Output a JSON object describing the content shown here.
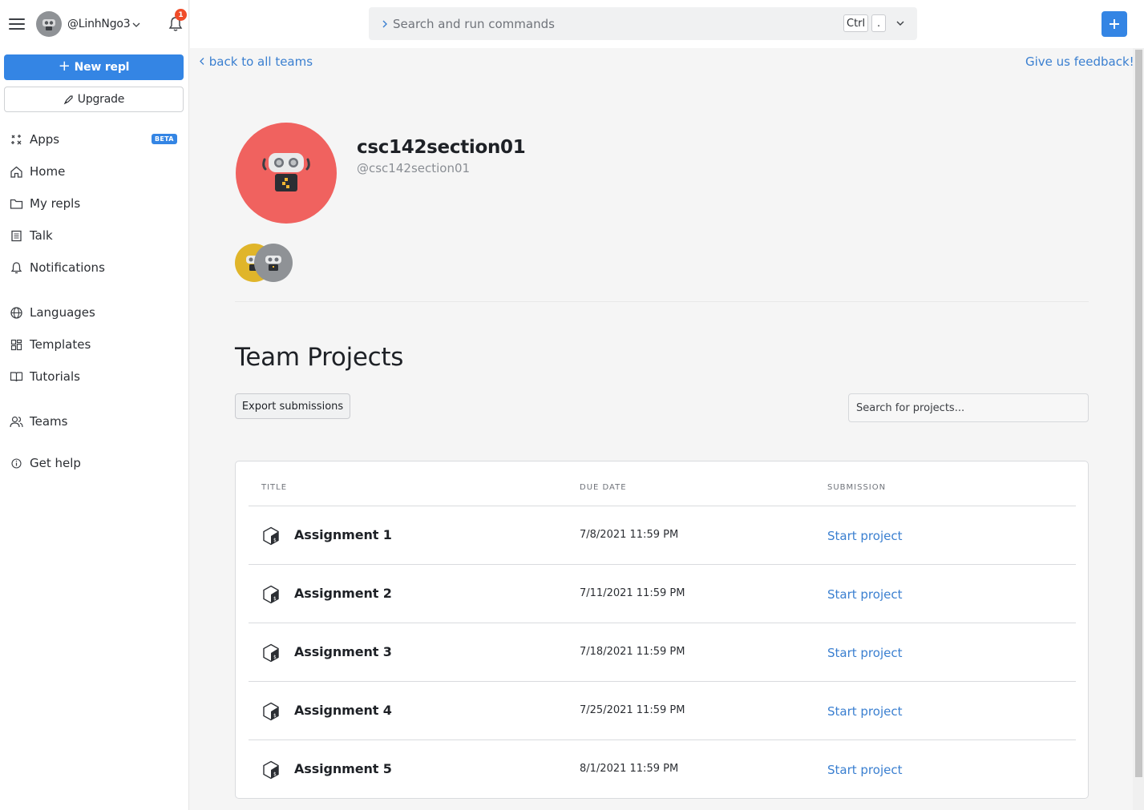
{
  "header": {
    "username": "@LinhNgo3",
    "notification_count": "1",
    "search_placeholder": "Search and run commands",
    "kbd_ctrl": "Ctrl",
    "kbd_dot": "."
  },
  "sidebar": {
    "new_repl_label": "New repl",
    "upgrade_label": "Upgrade",
    "beta_badge": "BETA",
    "items": [
      {
        "label": "Apps",
        "icon": "apps-icon"
      },
      {
        "label": "Home",
        "icon": "home-icon"
      },
      {
        "label": "My repls",
        "icon": "folder-icon"
      },
      {
        "label": "Talk",
        "icon": "talk-icon"
      },
      {
        "label": "Notifications",
        "icon": "bell-icon"
      },
      {
        "label": "Languages",
        "icon": "globe-icon"
      },
      {
        "label": "Templates",
        "icon": "templates-icon"
      },
      {
        "label": "Tutorials",
        "icon": "book-icon"
      },
      {
        "label": "Teams",
        "icon": "teams-icon"
      },
      {
        "label": "Get help",
        "icon": "info-icon"
      }
    ]
  },
  "page": {
    "back_link": "back to all teams",
    "feedback_link": "Give us feedback!",
    "team_name": "csc142section01",
    "team_handle": "@csc142section01",
    "section_title": "Team Projects",
    "export_label": "Export submissions",
    "search_placeholder": "Search for projects..."
  },
  "table": {
    "columns": [
      "TITLE",
      "DUE DATE",
      "SUBMISSION"
    ],
    "rows": [
      {
        "title": "Assignment 1",
        "due": "7/8/2021 11:59 PM",
        "action": "Start project"
      },
      {
        "title": "Assignment 2",
        "due": "7/11/2021 11:59 PM",
        "action": "Start project"
      },
      {
        "title": "Assignment 3",
        "due": "7/18/2021 11:59 PM",
        "action": "Start project"
      },
      {
        "title": "Assignment 4",
        "due": "7/25/2021 11:59 PM",
        "action": "Start project"
      },
      {
        "title": "Assignment 5",
        "due": "8/1/2021 11:59 PM",
        "action": "Start project"
      }
    ]
  },
  "colors": {
    "accent": "#3485e4",
    "link": "#3a7fd0",
    "team_avatar_bg": "#f0625f",
    "member1_bg": "#e0b52a",
    "member2_bg": "#8f9296",
    "badge": "#f04b28"
  }
}
